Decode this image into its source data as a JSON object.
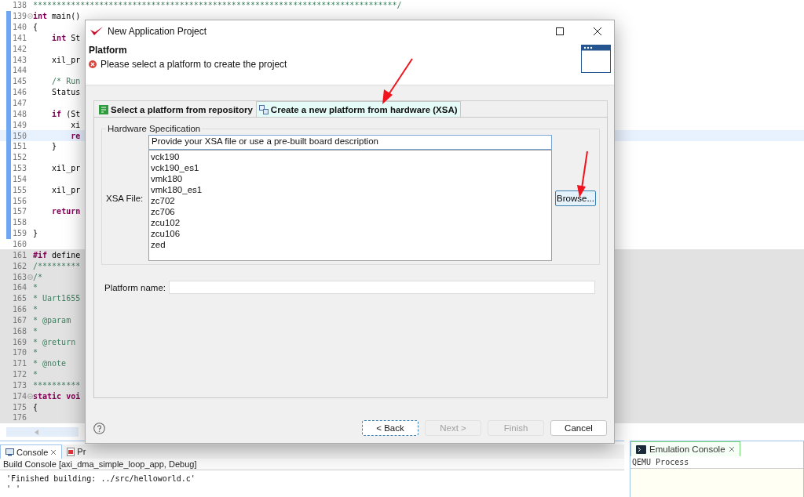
{
  "editor": {
    "lines": [
      {
        "n": "138",
        "comment": true,
        "code": "*****************************************************************************/"
      },
      {
        "n": "139",
        "fold": true,
        "code": "**int** main()"
      },
      {
        "n": "140",
        "code": "{"
      },
      {
        "n": "141",
        "code": "    **int** St"
      },
      {
        "n": "142"
      },
      {
        "n": "143",
        "code": "    xil_pr"
      },
      {
        "n": "144"
      },
      {
        "n": "145",
        "comment": true,
        "code": "    /* Run"
      },
      {
        "n": "146",
        "code": "    Status"
      },
      {
        "n": "147"
      },
      {
        "n": "148",
        "code": "    **if** (St"
      },
      {
        "n": "149",
        "code": "        xi"
      },
      {
        "n": "150",
        "current": true,
        "code": "        **re**"
      },
      {
        "n": "151",
        "code": "    }"
      },
      {
        "n": "152"
      },
      {
        "n": "153",
        "code": "    xil_pr"
      },
      {
        "n": "154"
      },
      {
        "n": "155",
        "code": "    xil_pr"
      },
      {
        "n": "156"
      },
      {
        "n": "157",
        "code": "    **return**"
      },
      {
        "n": "158"
      },
      {
        "n": "159",
        "code": "}"
      },
      {
        "n": "160"
      },
      {
        "n": "161",
        "shaded": true,
        "code": "**#if** define"
      },
      {
        "n": "162",
        "shaded": true,
        "comment": true,
        "code": "/*********"
      },
      {
        "n": "163",
        "shaded": true,
        "fold": true,
        "comment": true,
        "code": "/*"
      },
      {
        "n": "164",
        "shaded": true,
        "comment": true,
        "code": "*"
      },
      {
        "n": "165",
        "shaded": true,
        "comment": true,
        "code": "* Uart1655"
      },
      {
        "n": "166",
        "shaded": true,
        "comment": true,
        "code": "*"
      },
      {
        "n": "167",
        "shaded": true,
        "comment": true,
        "code": "* @param"
      },
      {
        "n": "168",
        "shaded": true,
        "comment": true,
        "code": "*"
      },
      {
        "n": "169",
        "shaded": true,
        "comment": true,
        "code": "* @return"
      },
      {
        "n": "170",
        "shaded": true,
        "comment": true,
        "code": "*"
      },
      {
        "n": "171",
        "shaded": true,
        "comment": true,
        "code": "* @note"
      },
      {
        "n": "172",
        "shaded": true,
        "comment": true,
        "code": "*"
      },
      {
        "n": "173",
        "shaded": true,
        "comment": true,
        "code": "**********"
      },
      {
        "n": "174",
        "shaded": true,
        "fold": true,
        "code": "**static voi**"
      },
      {
        "n": "175",
        "shaded": true,
        "code": "{"
      },
      {
        "n": "176",
        "shaded": true
      }
    ]
  },
  "console": {
    "tabs": [
      {
        "label": "Console",
        "selected": true,
        "kind": "console"
      },
      {
        "label": "Pr",
        "selected": false,
        "kind": "problems"
      }
    ],
    "header": "Build Console [axi_dma_simple_loop_app, Debug]",
    "lines": [
      "'Finished building: ../src/helloworld.c'",
      "' '"
    ]
  },
  "emulation": {
    "tab": "Emulation Console",
    "header": "QEMU Process"
  },
  "dialog": {
    "title": "New Application Project",
    "page_title": "Platform",
    "message": "Please select a platform to create the project",
    "tabs": [
      {
        "label": "Select a platform from repository",
        "selected": false
      },
      {
        "label": "Create a new platform from hardware (XSA)",
        "selected": true
      }
    ],
    "group_title": "Hardware Specification",
    "xsa_label": "XSA File:",
    "xsa_value": "Provide your XSA file or use a pre-built board description",
    "boards": [
      "vck190",
      "vck190_es1",
      "vmk180",
      "vmk180_es1",
      "zc702",
      "zc706",
      "zcu102",
      "zcu106",
      "zed"
    ],
    "browse": "Browse...",
    "platform_label": "Platform name:",
    "buttons": [
      {
        "label": "< Back",
        "disabled": false,
        "focused": true
      },
      {
        "label": "Next >",
        "disabled": true,
        "focused": false
      },
      {
        "label": "Finish",
        "disabled": true,
        "focused": false
      },
      {
        "label": "Cancel",
        "disabled": false,
        "focused": false
      }
    ]
  }
}
